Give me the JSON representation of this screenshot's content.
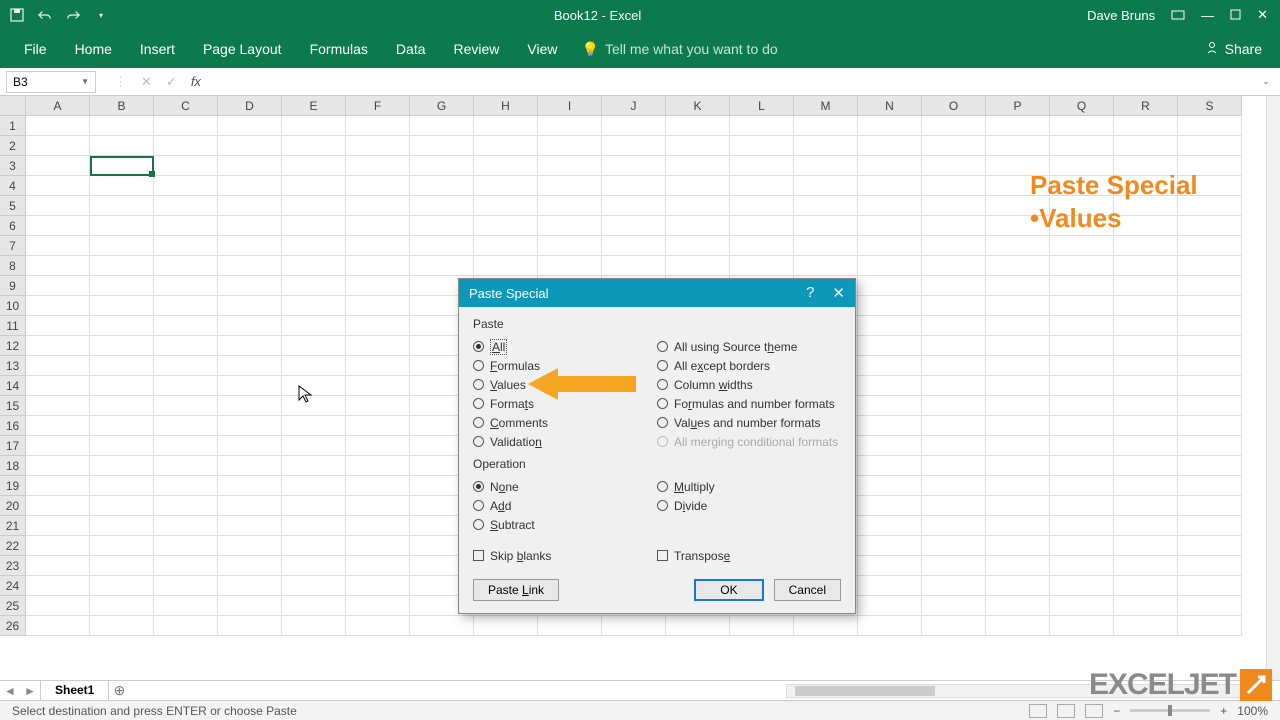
{
  "titlebar": {
    "title": "Book12 - Excel",
    "user": "Dave Bruns"
  },
  "ribbon": {
    "tabs": [
      "File",
      "Home",
      "Insert",
      "Page Layout",
      "Formulas",
      "Data",
      "Review",
      "View"
    ],
    "tellme": "Tell me what you want to do",
    "share": "Share"
  },
  "formula_bar": {
    "namebox": "B3",
    "fx": "fx"
  },
  "grid": {
    "columns": [
      "A",
      "B",
      "C",
      "D",
      "E",
      "F",
      "G",
      "H",
      "I",
      "J",
      "K",
      "L",
      "M",
      "N",
      "O",
      "P",
      "Q",
      "R",
      "S"
    ],
    "rows": [
      "1",
      "2",
      "3",
      "4",
      "5",
      "6",
      "7",
      "8",
      "9",
      "10",
      "11",
      "12",
      "13",
      "14",
      "15",
      "16",
      "17",
      "18",
      "19",
      "20",
      "21",
      "22",
      "23",
      "24",
      "25",
      "26"
    ],
    "selected_cell": "B3"
  },
  "overlay": {
    "line1": "Paste Special",
    "line2": "•Values"
  },
  "dialog": {
    "title": "Paste Special",
    "section_paste": "Paste",
    "section_operation": "Operation",
    "paste_left": {
      "all": "All",
      "formulas": "Formulas",
      "values": "Values",
      "formats": "Formats",
      "comments": "Comments",
      "validation": "Validation"
    },
    "paste_right": {
      "all_theme": "All using Source theme",
      "all_except_borders": "All except borders",
      "column_widths": "Column widths",
      "formulas_num": "Formulas and number formats",
      "values_num": "Values and number formats",
      "all_merging": "All merging conditional formats"
    },
    "op_left": {
      "none": "None",
      "add": "Add",
      "subtract": "Subtract"
    },
    "op_right": {
      "multiply": "Multiply",
      "divide": "Divide"
    },
    "skip_blanks": "Skip blanks",
    "transpose": "Transpose",
    "paste_link": "Paste Link",
    "ok": "OK",
    "cancel": "Cancel"
  },
  "sheets": {
    "active": "Sheet1"
  },
  "statusbar": {
    "message": "Select destination and press ENTER or choose Paste",
    "zoom": "100%"
  },
  "logo": "EXCELJET"
}
